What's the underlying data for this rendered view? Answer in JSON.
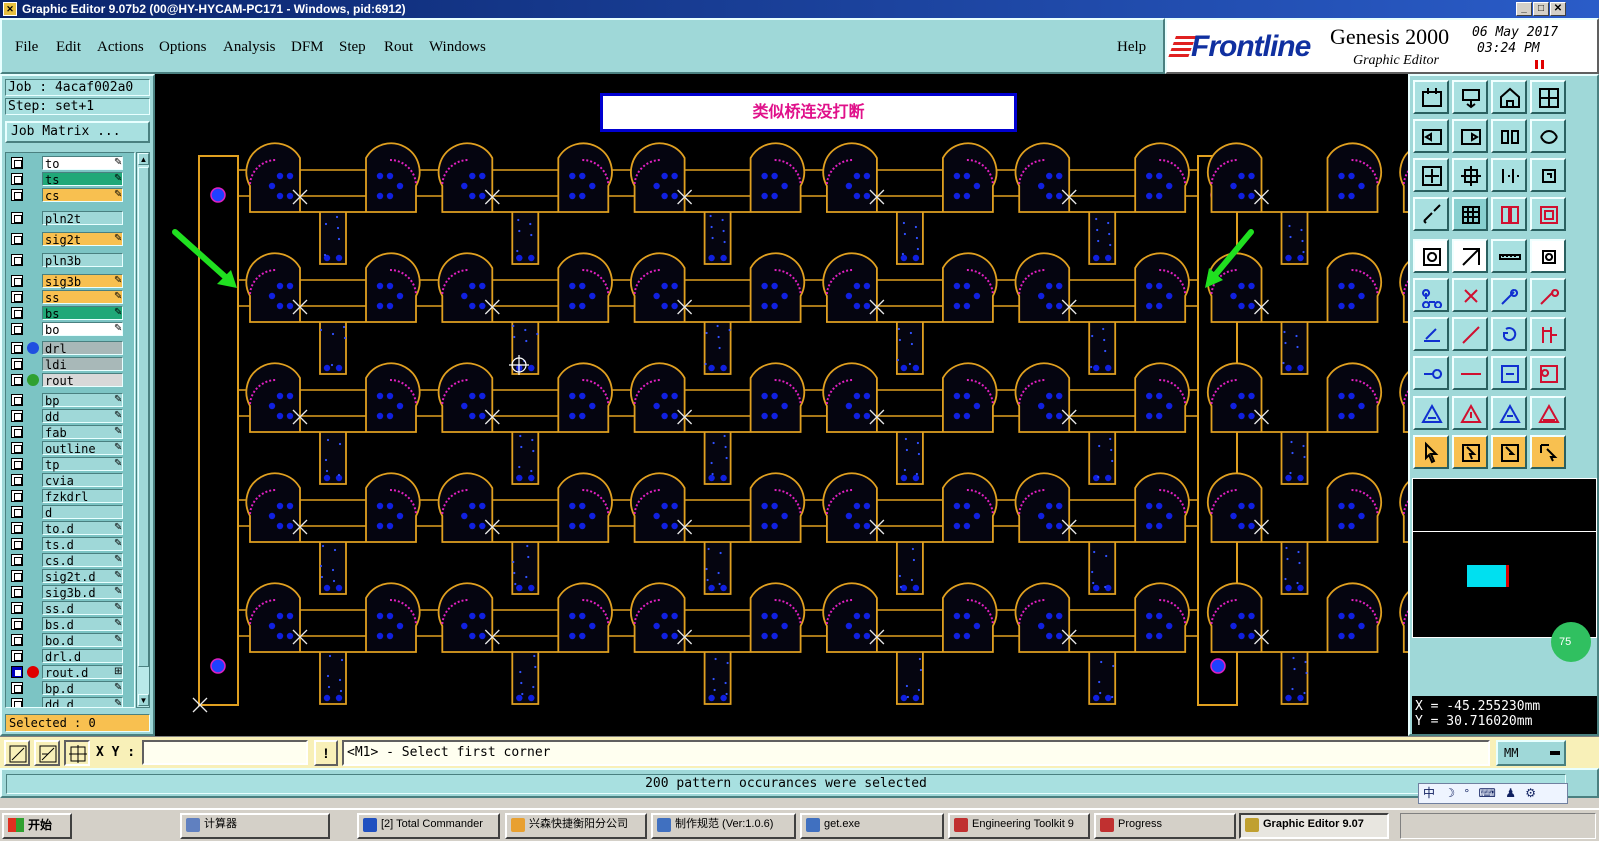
{
  "window": {
    "title": "Graphic Editor 9.07b2 (00@HY-HYCAM-PC171 - Windows, pid:6912)"
  },
  "menu": {
    "items": [
      "File",
      "Edit",
      "Actions",
      "Options",
      "Analysis",
      "DFM",
      "Step",
      "Rout",
      "Windows"
    ],
    "help": "Help"
  },
  "brand": {
    "logo": "Frontline",
    "product": "Genesis 2000",
    "subtitle": "Graphic Editor",
    "date": "06 May 2017",
    "time": "03:24 PM"
  },
  "job": {
    "job_line": "Job : 4acaf002a0",
    "step_line": "Step: set+1",
    "matrix_button": "Job Matrix ..."
  },
  "layers": [
    {
      "name": "to",
      "color": "#ffffff",
      "mark": "✎"
    },
    {
      "name": "ts",
      "color": "#20a878",
      "mark": "✎"
    },
    {
      "name": "cs",
      "color": "#f8c050",
      "mark": "✎"
    },
    {
      "name": "pln2t",
      "color": "#9fd8d8",
      "mark": ""
    },
    {
      "name": "sig2t",
      "color": "#f8c050",
      "mark": "✎"
    },
    {
      "name": "pln3b",
      "color": "#9fd8d8",
      "mark": ""
    },
    {
      "name": "sig3b",
      "color": "#f8c050",
      "mark": "✎"
    },
    {
      "name": "ss",
      "color": "#f8c050",
      "mark": "✎"
    },
    {
      "name": "bs",
      "color": "#20a878",
      "mark": "✎"
    },
    {
      "name": "bo",
      "color": "#ffffff",
      "mark": "✎"
    },
    {
      "name": "drl",
      "color": "#a8b8b8",
      "mark": "",
      "dot": "#2050e0"
    },
    {
      "name": "ldi",
      "color": "#a8b8b8",
      "mark": ""
    },
    {
      "name": "rout",
      "color": "#d8d8d8",
      "mark": "",
      "dot": "#30a030"
    },
    {
      "name": "bp",
      "color": "#9fd8d8",
      "mark": "✎"
    },
    {
      "name": "dd",
      "color": "#9fd8d8",
      "mark": "✎"
    },
    {
      "name": "fab",
      "color": "#9fd8d8",
      "mark": "✎"
    },
    {
      "name": "outline",
      "color": "#9fd8d8",
      "mark": "✎"
    },
    {
      "name": "tp",
      "color": "#9fd8d8",
      "mark": "✎"
    },
    {
      "name": "cvia",
      "color": "#9fd8d8",
      "mark": ""
    },
    {
      "name": "fzkdrl",
      "color": "#9fd8d8",
      "mark": ""
    },
    {
      "name": "d",
      "color": "#9fd8d8",
      "mark": ""
    },
    {
      "name": "to.d",
      "color": "#9fd8d8",
      "mark": "✎"
    },
    {
      "name": "ts.d",
      "color": "#9fd8d8",
      "mark": "✎"
    },
    {
      "name": "cs.d",
      "color": "#9fd8d8",
      "mark": "✎"
    },
    {
      "name": "sig2t.d",
      "color": "#9fd8d8",
      "mark": "✎"
    },
    {
      "name": "sig3b.d",
      "color": "#9fd8d8",
      "mark": "✎"
    },
    {
      "name": "ss.d",
      "color": "#9fd8d8",
      "mark": "✎"
    },
    {
      "name": "bs.d",
      "color": "#9fd8d8",
      "mark": "✎"
    },
    {
      "name": "bo.d",
      "color": "#9fd8d8",
      "mark": "✎"
    },
    {
      "name": "drl.d",
      "color": "#9fd8d8",
      "mark": ""
    },
    {
      "name": "rout.d",
      "color": "#9fd8d8",
      "mark": "⊞",
      "dot": "#e00000",
      "filled": true
    },
    {
      "name": "bp.d",
      "color": "#9fd8d8",
      "mark": "✎"
    },
    {
      "name": "dd.d",
      "color": "#9fd8d8",
      "mark": "✎"
    }
  ],
  "selected": "Selected : 0",
  "canvas": {
    "annotation": "类似桥连没打断",
    "panel_rows": 5,
    "panel_cols": 8
  },
  "coords": {
    "x_line": "X = -45.255230mm",
    "y_line": "Y = 30.716020mm"
  },
  "zoom_badge": "75",
  "command": {
    "xy_label": "X Y :",
    "xy_value": "",
    "info_button": "!",
    "prompt": "<M1> - Select first corner",
    "units": "MM"
  },
  "status": "200 pattern occurances were selected",
  "ime": "中 ☽ ° ⌨ ♟ ⚙",
  "taskbar": {
    "start": "开始",
    "tasks": [
      {
        "label": "计算器",
        "color": "#6080c0"
      },
      {
        "label": "[2] Total Commander",
        "color": "#2050c0"
      },
      {
        "label": "兴森快捷衡阳分公司",
        "color": "#e8a030"
      },
      {
        "label": "制作规范 (Ver:1.0.6)",
        "color": "#4070c0"
      },
      {
        "label": "get.exe",
        "color": "#4070c0"
      },
      {
        "label": "Engineering Toolkit 9",
        "color": "#c03030"
      },
      {
        "label": "Progress",
        "color": "#c03030"
      },
      {
        "label": "Graphic Editor 9.07",
        "color": "#c0a030"
      }
    ]
  },
  "colors": {
    "menu_bg": "#9fd8d8",
    "canvas_bg": "#000000",
    "outline": "#e0a020",
    "pad": "#1020e0",
    "drill_blue": "#2040ff",
    "arc_magenta": "#e020c0",
    "arrow_green": "#20e020"
  }
}
